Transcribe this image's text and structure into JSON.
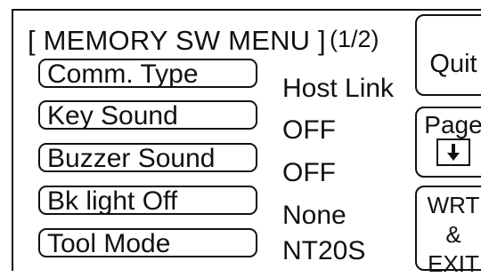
{
  "window": {
    "title": "[ MEMORY SW MENU ]",
    "page_indicator": "(1/2)"
  },
  "menu": {
    "items": [
      {
        "label": "Comm. Type",
        "value": "Host Link"
      },
      {
        "label": "Key Sound",
        "value": "OFF"
      },
      {
        "label": "Buzzer Sound",
        "value": "OFF"
      },
      {
        "label": "Bk light Off",
        "value": "None"
      },
      {
        "label": "Tool Mode",
        "value": "NT20S"
      }
    ]
  },
  "buttons": {
    "quit": "Quit",
    "page": "Page",
    "page_icon": "down-arrow-icon",
    "wrt_line1": "WRT",
    "wrt_line2": "&",
    "wrt_line3": "EXIT"
  }
}
